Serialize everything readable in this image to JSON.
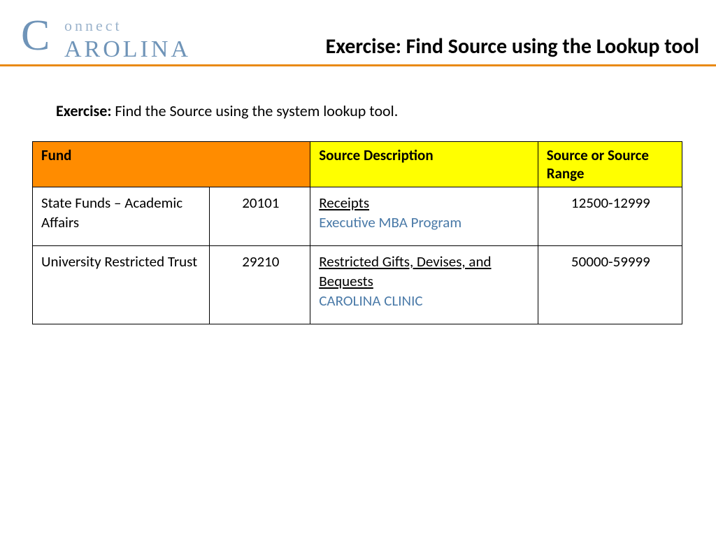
{
  "logo": {
    "bigC": "C",
    "onnect": "onnect",
    "arolina": "AROLINA"
  },
  "title": "Exercise: Find Source using the Lookup tool",
  "exercise": {
    "label": "Exercise:",
    "text": "  Find the Source using the system lookup tool."
  },
  "table": {
    "headers": {
      "fund": "Fund",
      "sourceDesc": "Source Description",
      "sourceRange": "Source or Source Range"
    },
    "rows": [
      {
        "fundName": "State Funds – Academic Affairs",
        "fundCode": "20101",
        "descUnderline": "Receipts",
        "descBlue": "Executive MBA Program",
        "range": "12500-12999"
      },
      {
        "fundName": "University Restricted Trust",
        "fundCode": "29210",
        "descUnderline": "Restricted Gifts, Devises, and Bequests",
        "descBlue": "CAROLINA CLINIC",
        "range": "50000-59999"
      }
    ]
  }
}
